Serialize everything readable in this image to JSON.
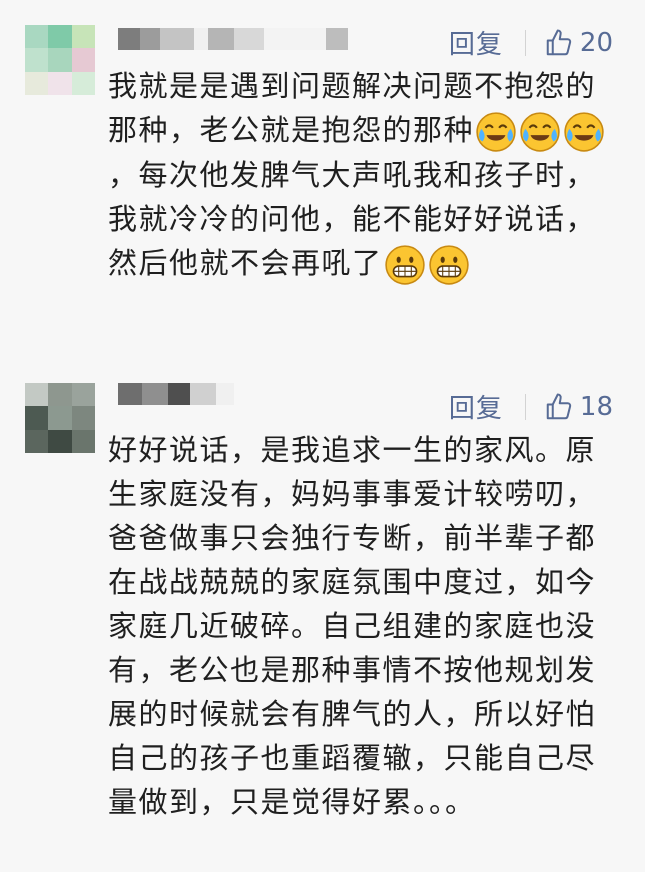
{
  "comments": [
    {
      "reply_label": "回复",
      "likes": "20",
      "text_parts": [
        "我就是是遇到问题解决问题不抱怨的那种，老公就是抱怨的那种",
        "，每次他发脾气大声吼我和孩子时，我就冷冷的问他，能不能好好说话，然后他就不会再吼了"
      ],
      "emojis": [
        "crying-laughing-emoji",
        "grinning-emoji"
      ]
    },
    {
      "reply_label": "回复",
      "likes": "18",
      "text": "好好说话，是我追求一生的家风。原生家庭没有，妈妈事事爱计较唠叨，爸爸做事只会独行专断，前半辈子都在战战兢兢的家庭氛围中度过，如今家庭几近破碎。自己组建的家庭也没有，老公也是那种事情不按他规划发展的时候就会有脾气的人，所以好怕自己的孩子也重蹈覆辙，只能自己尽量做到，只是觉得好累。。。"
    }
  ],
  "colors": {
    "background": "#f7f7f7",
    "link": "#576b95",
    "text": "#1f1f1f"
  }
}
